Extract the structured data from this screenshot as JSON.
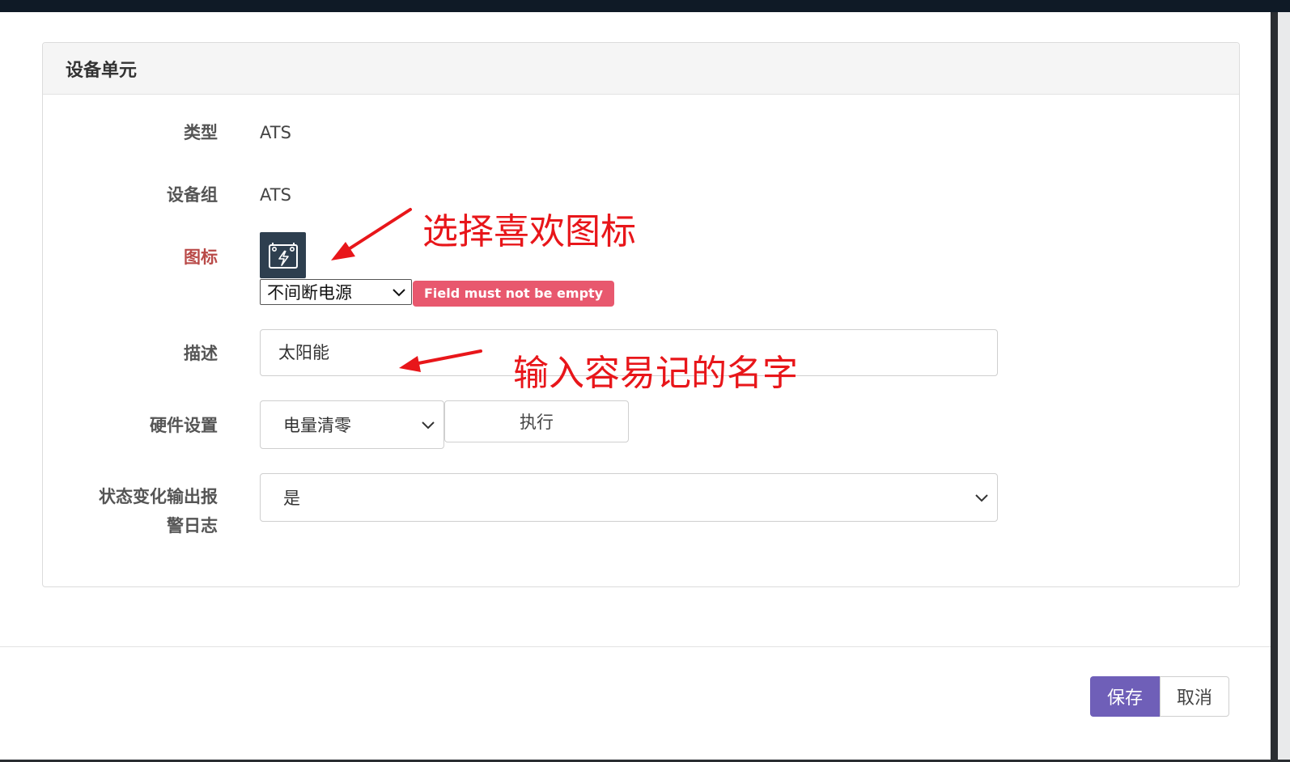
{
  "panel": {
    "title": "设备单元"
  },
  "form": {
    "type": {
      "label": "类型",
      "value": "ATS"
    },
    "device_group": {
      "label": "设备组",
      "value": "ATS"
    },
    "icon": {
      "label": "图标",
      "selected": "不间断电源",
      "error": "Field must not be empty"
    },
    "description": {
      "label": "描述",
      "value": "太阳能"
    },
    "hardware": {
      "label": "硬件设置",
      "selected": "电量清零",
      "execute_label": "执行"
    },
    "alarm_log": {
      "label_line1": "状态变化输出报",
      "label_line2": "警日志",
      "selected": "是"
    }
  },
  "footer": {
    "save_label": "保存",
    "cancel_label": "取消"
  },
  "annotations": {
    "icon_hint": "选择喜欢图标",
    "name_hint": "输入容易记的名字",
    "color": "#e8161a"
  },
  "colors": {
    "primary": "#6f5fb8",
    "error_badge": "#e8586e",
    "error_label": "#b94a48",
    "icon_bg": "#2e3f4f"
  }
}
